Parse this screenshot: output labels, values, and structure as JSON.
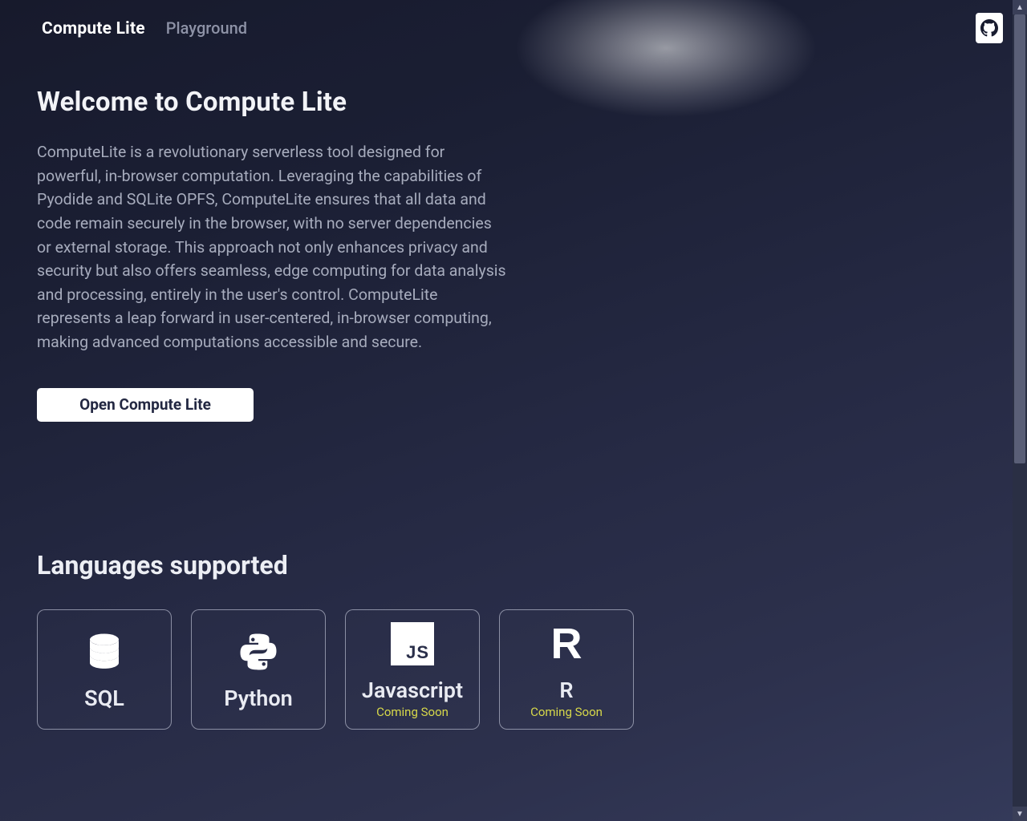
{
  "nav": {
    "brand": "Compute Lite",
    "playground": "Playground"
  },
  "hero": {
    "title": "Welcome to Compute Lite",
    "description": "ComputeLite is a revolutionary serverless tool designed for powerful, in-browser computation. Leveraging the capabilities of Pyodide and SQLite OPFS, ComputeLite ensures that all data and code remain securely in the browser, with no server dependencies or external storage. This approach not only enhances privacy and security but also offers seamless, edge computing for data analysis and processing, entirely in the user's control. ComputeLite represents a leap forward in user-centered, in-browser computing, making advanced computations accessible and secure.",
    "open_button": "Open Compute Lite"
  },
  "languages": {
    "heading": "Languages supported",
    "items": [
      {
        "name": "SQL",
        "note": ""
      },
      {
        "name": "Python",
        "note": ""
      },
      {
        "name": "Javascript",
        "note": "Coming Soon"
      },
      {
        "name": "R",
        "note": "Coming Soon"
      }
    ]
  },
  "js_icon_text": "JS"
}
